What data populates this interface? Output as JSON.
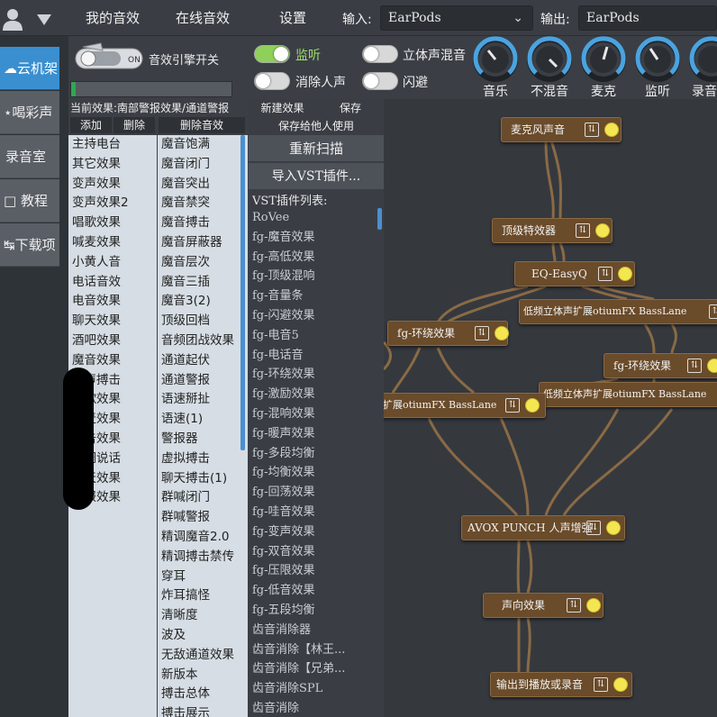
{
  "topbar": {
    "tabs": [
      "我的音效",
      "在线音效",
      "设置"
    ],
    "input_label": "输入:",
    "input_value": "EarPods",
    "output_label": "输出:",
    "output_value": "EarPods"
  },
  "leftnav": {
    "items": [
      "云机架",
      "喝彩声",
      "录音室",
      "教程",
      "下载项"
    ],
    "active": "云机架"
  },
  "engine": {
    "switch_label": "音效引擎开关"
  },
  "toggles": {
    "monitor": {
      "label": "监听",
      "on": true
    },
    "remove_vocal": {
      "label": "消除人声",
      "on": false
    },
    "stereo_mix": {
      "label": "立体声混音",
      "on": false
    },
    "ducking": {
      "label": "闪避",
      "on": false
    }
  },
  "knobs": [
    "音乐",
    "不混音",
    "麦克",
    "监听",
    "录音"
  ],
  "current_effect": "当前效果:南部警报效果/通道警报",
  "list_buttons": [
    "添加",
    "删除",
    "删除音效"
  ],
  "effect_list": [
    "主持电台",
    "其它效果",
    "变声效果",
    "变声效果2",
    "唱歌效果",
    "喊麦效果",
    "小黄人音",
    "电话音效",
    "电音效果",
    "聊天效果",
    "酒吧效果",
    "魔音效果",
    "人声搏击",
    "唱歌效果",
    "喊麦效果",
    "搏击效果",
    "精调说话",
    "聊天效果",
    "警报效果"
  ],
  "sound_list": [
    "魔音饱满",
    "魔音闭门",
    "魔音突出",
    "魔音禁突",
    "魔音搏击",
    "魔音屏蔽器",
    "魔音层次",
    "魔音三插",
    "魔音3(2)",
    "顶级回档",
    "音频团战效果",
    "通道起伏",
    "通道警报",
    "语速掰扯",
    "语速(1)",
    "警报器",
    "虚拟搏击",
    "聊天搏击(1)",
    "群喊闭门",
    "群喊警报",
    "精调魔音2.0",
    "精调搏击禁传",
    "穿耳",
    "炸耳搞怪",
    "清晰度",
    "波及",
    "无敌通道效果",
    "新版本",
    "搏击总体",
    "搏击展示"
  ],
  "vst": {
    "btn_new": "新建效果",
    "btn_save": "保存",
    "btn_share": "保存给他人使用",
    "btn_rescan": "重新扫描",
    "btn_import": "导入VST插件...",
    "list_title": "VST插件列表:",
    "plugins": [
      "RoVee",
      "fg-魔音效果",
      "fg-高低效果",
      "fg-顶级混响",
      "fg-音量条",
      "fg-闪避效果",
      "fg-电音5",
      "fg-电话音",
      "fg-环绕效果",
      "fg-激励效果",
      "fg-混响效果",
      "fg-暖声效果",
      "fg-多段均衡",
      "fg-均衡效果",
      "fg-回荡效果",
      "fg-哇音效果",
      "fg-变声效果",
      "fg-双音效果",
      "fg-压限效果",
      "fg-低音效果",
      "fg-五段均衡",
      "齿音消除器",
      "齿音消除【林王...",
      "齿音消除【兄弟...",
      "齿音消除SPL",
      "齿音消除"
    ]
  },
  "graph_nodes": {
    "mic": "麦克风声音",
    "top_effect": "顶级特效器",
    "eq": "EQ-EasyQ",
    "bass1": "低频立体声扩展otiumFX BassLane",
    "surround1": "fg-环绕效果",
    "surround2": "fg-环绕效果",
    "bass2": "低频立体声扩展otiumFX BassLane",
    "bass3": "扩展otiumFX BassLane",
    "avox": "AVOX PUNCH 人声增强",
    "sound_effect": "声向效果",
    "output": "输出到播放或录音"
  },
  "icons": {
    "eq_icon": "equalizer-icon",
    "power": "yellow-led-icon"
  },
  "colors": {
    "accent": "#3a8fd0",
    "node": "#6a4b2a",
    "toggle_on": "#8ed05a",
    "led": "#f3e650"
  }
}
